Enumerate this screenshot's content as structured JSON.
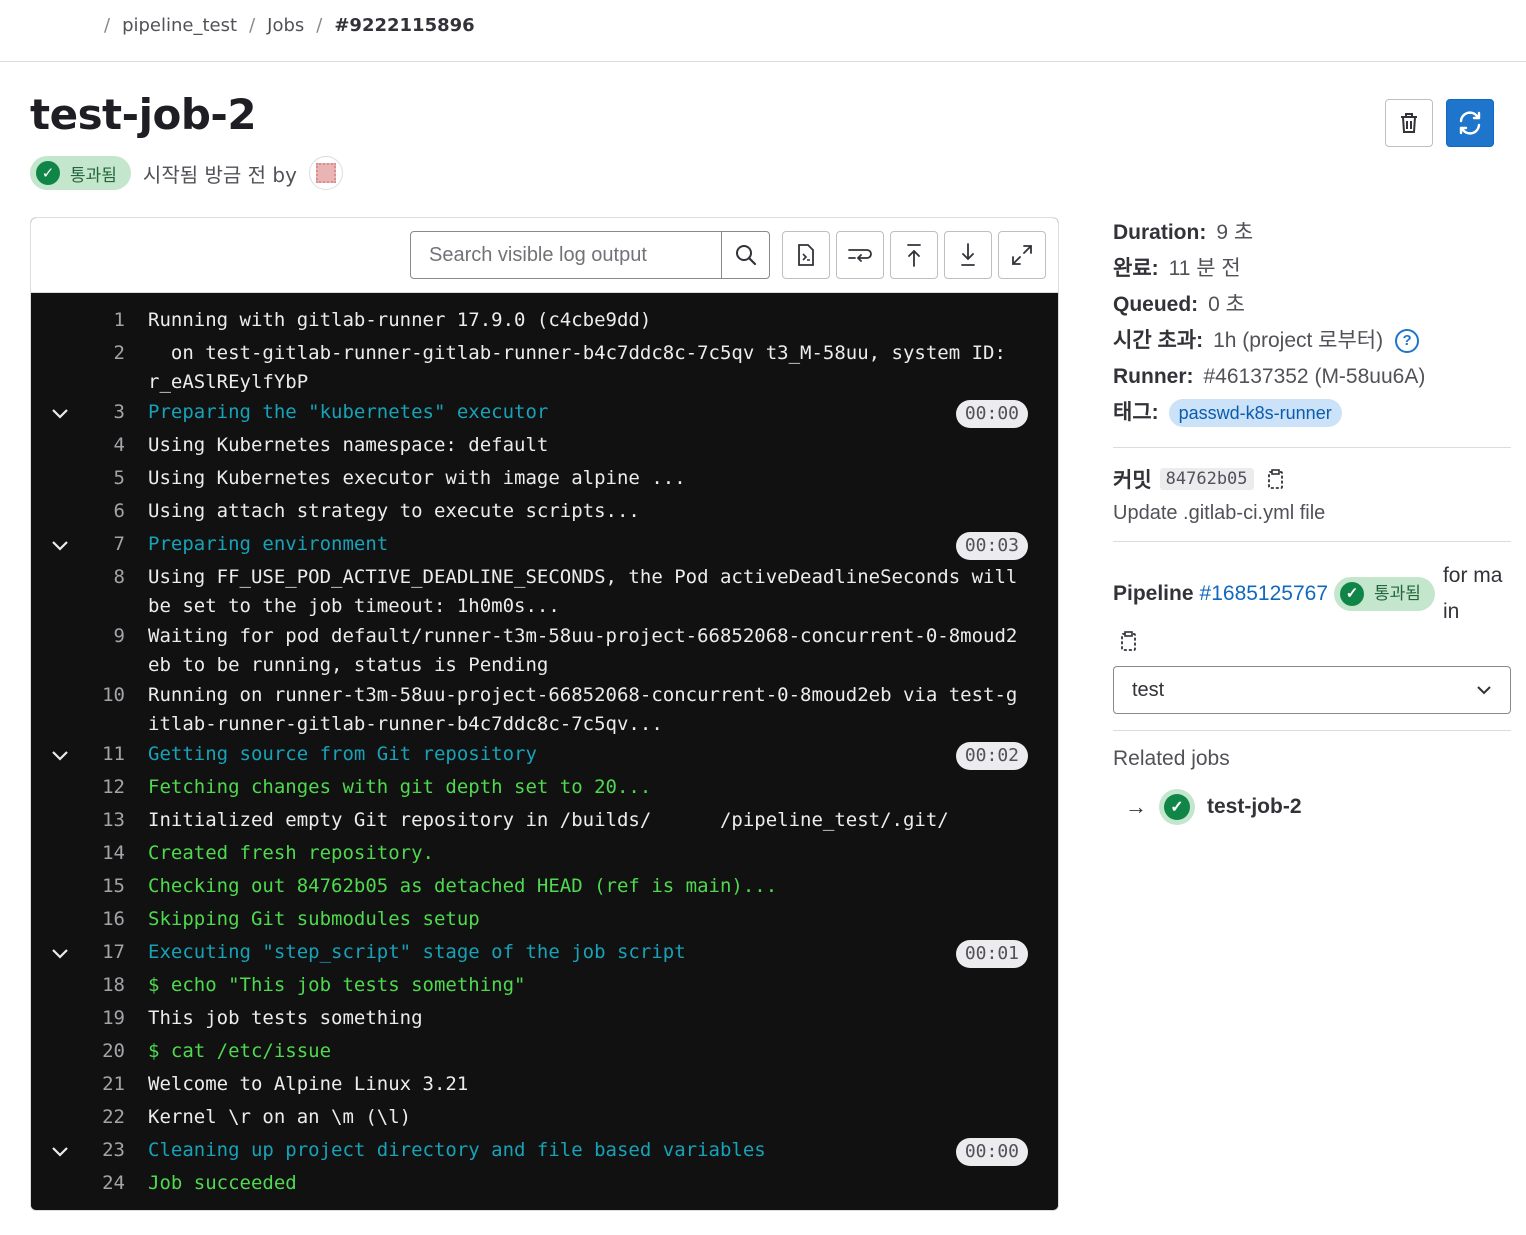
{
  "breadcrumb": {
    "items": [
      "pipeline_test",
      "Jobs"
    ],
    "current": "#9222115896"
  },
  "job": {
    "title": "test-job-2",
    "status": "통과됨",
    "started_text": "시작됨 방금 전 by"
  },
  "actions": {
    "delete": "delete-icon",
    "retry": "retry-icon"
  },
  "log": {
    "search_placeholder": "Search visible log output",
    "lines": [
      {
        "n": "1",
        "text": "Running with gitlab-runner 17.9.0 (c4cbe9dd)",
        "style": "normal",
        "section": false,
        "duration": ""
      },
      {
        "n": "2",
        "text": "  on test-gitlab-runner-gitlab-runner-b4c7ddc8c-7c5qv t3_M-58uu, system ID: r_eASlREylfYbP",
        "style": "normal",
        "section": false,
        "duration": ""
      },
      {
        "n": "3",
        "text": "Preparing the \"kubernetes\" executor",
        "style": "section",
        "section": true,
        "duration": "00:00"
      },
      {
        "n": "4",
        "text": "Using Kubernetes namespace: default",
        "style": "normal",
        "section": false,
        "duration": ""
      },
      {
        "n": "5",
        "text": "Using Kubernetes executor with image alpine ...",
        "style": "normal",
        "section": false,
        "duration": ""
      },
      {
        "n": "6",
        "text": "Using attach strategy to execute scripts...",
        "style": "normal",
        "section": false,
        "duration": ""
      },
      {
        "n": "7",
        "text": "Preparing environment",
        "style": "section",
        "section": true,
        "duration": "00:03"
      },
      {
        "n": "8",
        "text": "Using FF_USE_POD_ACTIVE_DEADLINE_SECONDS, the Pod activeDeadlineSeconds will be set to the job timeout: 1h0m0s...",
        "style": "normal",
        "section": false,
        "duration": ""
      },
      {
        "n": "9",
        "text": "Waiting for pod default/runner-t3m-58uu-project-66852068-concurrent-0-8moud2eb to be running, status is Pending",
        "style": "normal",
        "section": false,
        "duration": ""
      },
      {
        "n": "10",
        "text": "Running on runner-t3m-58uu-project-66852068-concurrent-0-8moud2eb via test-gitlab-runner-gitlab-runner-b4c7ddc8c-7c5qv...",
        "style": "normal",
        "section": false,
        "duration": ""
      },
      {
        "n": "11",
        "text": "Getting source from Git repository",
        "style": "section",
        "section": true,
        "duration": "00:02"
      },
      {
        "n": "12",
        "text": "Fetching changes with git depth set to 20...",
        "style": "green",
        "section": false,
        "duration": ""
      },
      {
        "n": "13",
        "text": "Initialized empty Git repository in /builds/      /pipeline_test/.git/",
        "style": "normal",
        "section": false,
        "duration": ""
      },
      {
        "n": "14",
        "text": "Created fresh repository.",
        "style": "green",
        "section": false,
        "duration": ""
      },
      {
        "n": "15",
        "text": "Checking out 84762b05 as detached HEAD (ref is main)...",
        "style": "green",
        "section": false,
        "duration": ""
      },
      {
        "n": "16",
        "text": "Skipping Git submodules setup",
        "style": "green",
        "section": false,
        "duration": ""
      },
      {
        "n": "17",
        "text": "Executing \"step_script\" stage of the job script",
        "style": "section",
        "section": true,
        "duration": "00:01"
      },
      {
        "n": "18",
        "text": "$ echo \"This job tests something\"",
        "style": "green",
        "section": false,
        "duration": ""
      },
      {
        "n": "19",
        "text": "This job tests something",
        "style": "normal",
        "section": false,
        "duration": ""
      },
      {
        "n": "20",
        "text": "$ cat /etc/issue",
        "style": "green",
        "section": false,
        "duration": ""
      },
      {
        "n": "21",
        "text": "Welcome to Alpine Linux 3.21",
        "style": "normal",
        "section": false,
        "duration": ""
      },
      {
        "n": "22",
        "text": "Kernel \\r on an \\m (\\l)",
        "style": "normal",
        "section": false,
        "duration": ""
      },
      {
        "n": "23",
        "text": "Cleaning up project directory and file based variables",
        "style": "section",
        "section": true,
        "duration": "00:00"
      },
      {
        "n": "24",
        "text": "Job succeeded",
        "style": "green",
        "section": false,
        "duration": ""
      }
    ]
  },
  "sidebar": {
    "duration_label": "Duration:",
    "duration_value": "9 초",
    "finished_label": "완료:",
    "finished_value": "11 분 전",
    "queued_label": "Queued:",
    "queued_value": "0 초",
    "timeout_label": "시간 초과:",
    "timeout_value": "1h (project 로부터)",
    "runner_label": "Runner:",
    "runner_value": "#46137352 (M-58uu6A)",
    "tags_label": "태그:",
    "tag": "passwd-k8s-runner",
    "commit_label": "커밋",
    "commit_sha": "84762b05",
    "commit_message": "Update .gitlab-ci.yml file",
    "pipeline_label": "Pipeline",
    "pipeline_id": "#1685125767",
    "pipeline_status": "통과됨",
    "pipeline_ref_text": "for main",
    "stage_select": "test",
    "related_title": "Related jobs",
    "related_job": "test-job-2"
  }
}
